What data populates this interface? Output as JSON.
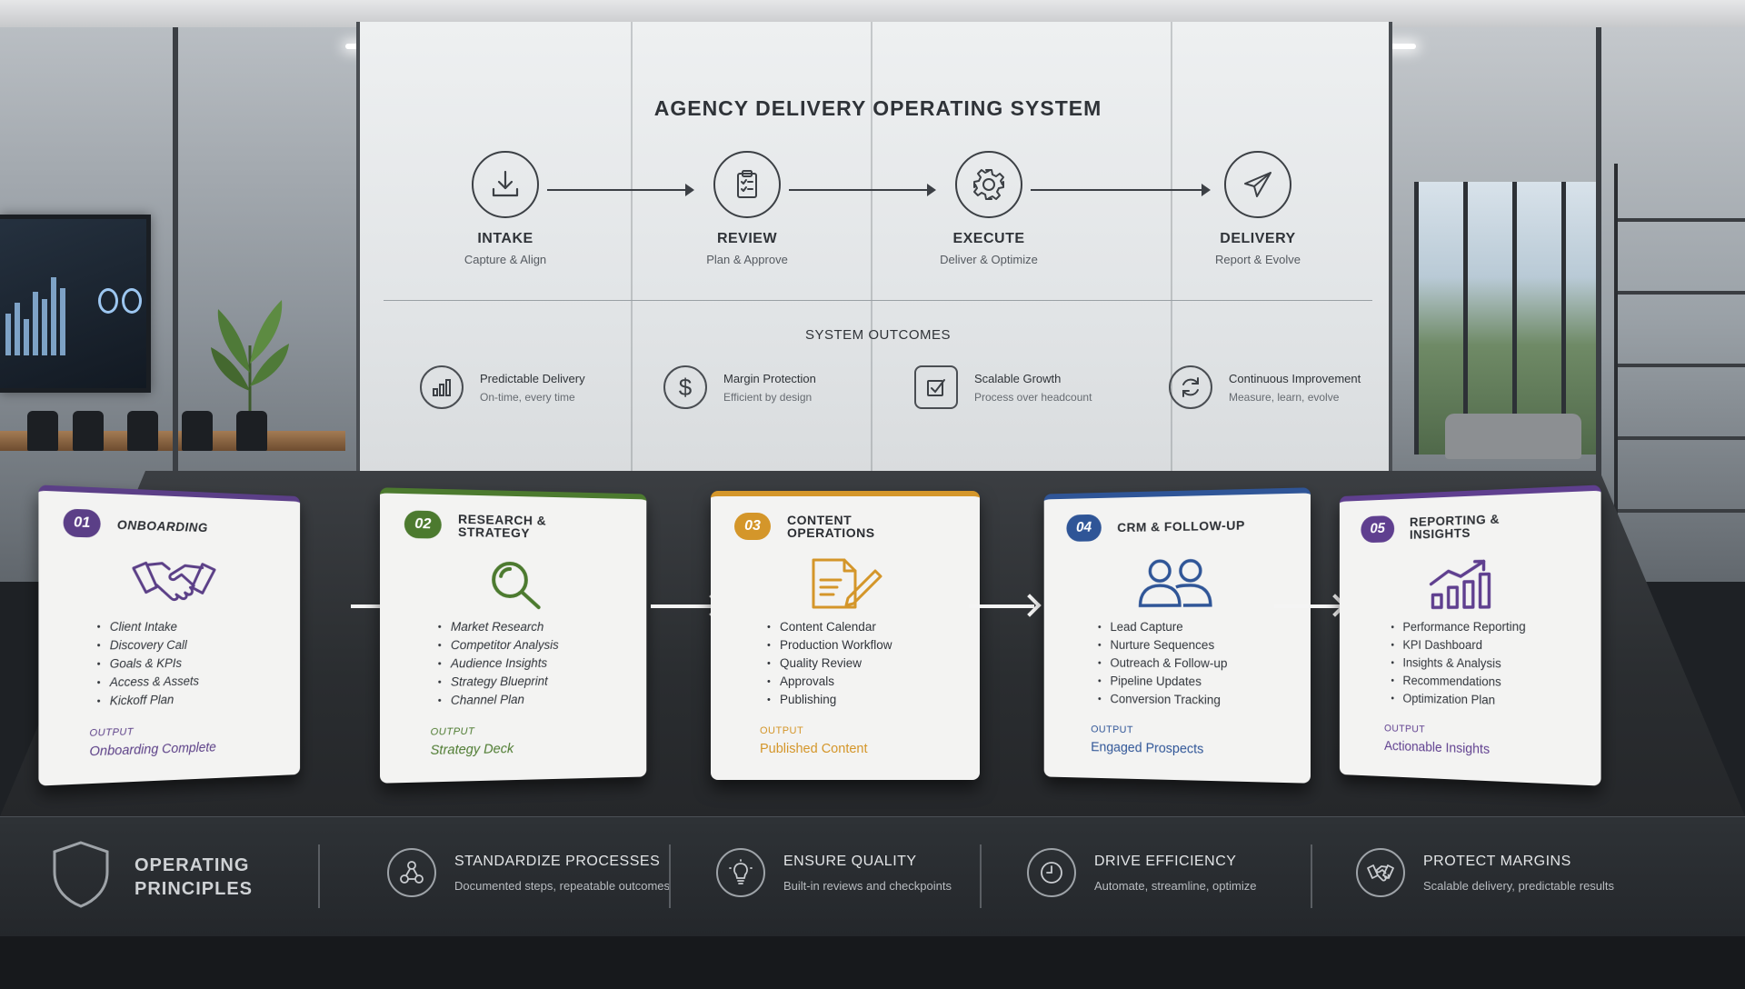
{
  "board": {
    "title": "AGENCY DELIVERY OPERATING SYSTEM",
    "stages": [
      {
        "title": "INTAKE",
        "subtitle": "Capture & Align",
        "icon": "download-icon"
      },
      {
        "title": "REVIEW",
        "subtitle": "Plan & Approve",
        "icon": "clipboard-check-icon"
      },
      {
        "title": "EXECUTE",
        "subtitle": "Deliver & Optimize",
        "icon": "gear-icon"
      },
      {
        "title": "DELIVERY",
        "subtitle": "Report & Evolve",
        "icon": "paper-plane-icon"
      }
    ],
    "outcomes_title": "SYSTEM OUTCOMES",
    "outcomes": [
      {
        "title": "Predictable Delivery",
        "subtitle": "On-time, every time",
        "icon": "bar-chart-icon"
      },
      {
        "title": "Margin Protection",
        "subtitle": "Efficient by design",
        "icon": "dollar-icon"
      },
      {
        "title": "Scalable Growth",
        "subtitle": "Process over headcount",
        "icon": "checkbox-icon"
      },
      {
        "title": "Continuous Improvement",
        "subtitle": "Measure, learn, evolve",
        "icon": "refresh-icon"
      }
    ]
  },
  "cards": [
    {
      "number": "01",
      "title": "ONBOARDING",
      "color": "#5b3f87",
      "icon": "handshake-icon",
      "items": [
        "Client Intake",
        "Discovery Call",
        "Goals & KPIs",
        "Access & Assets",
        "Kickoff Plan"
      ],
      "output_label": "OUTPUT",
      "output": "Onboarding Complete"
    },
    {
      "number": "02",
      "title": "RESEARCH & STRATEGY",
      "color": "#4c7a2f",
      "icon": "magnifier-icon",
      "items": [
        "Market Research",
        "Competitor Analysis",
        "Audience Insights",
        "Strategy Blueprint",
        "Channel Plan"
      ],
      "output_label": "OUTPUT",
      "output": "Strategy Deck"
    },
    {
      "number": "03",
      "title": "CONTENT OPERATIONS",
      "color": "#d4962a",
      "icon": "document-pen-icon",
      "items": [
        "Content Calendar",
        "Production Workflow",
        "Quality Review",
        "Approvals",
        "Publishing"
      ],
      "output_label": "OUTPUT",
      "output": "Published Content"
    },
    {
      "number": "04",
      "title": "CRM & FOLLOW-UP",
      "color": "#2f5597",
      "icon": "users-icon",
      "items": [
        "Lead Capture",
        "Nurture Sequences",
        "Outreach & Follow-up",
        "Pipeline Updates",
        "Conversion Tracking"
      ],
      "output_label": "OUTPUT",
      "output": "Engaged Prospects"
    },
    {
      "number": "05",
      "title": "REPORTING & INSIGHTS",
      "color": "#5f3f8f",
      "icon": "growth-chart-icon",
      "items": [
        "Performance Reporting",
        "KPI Dashboard",
        "Insights & Analysis",
        "Recommendations",
        "Optimization Plan"
      ],
      "output_label": "OUTPUT",
      "output": "Actionable Insights"
    }
  ],
  "principles": {
    "title": "OPERATING PRINCIPLES",
    "items": [
      {
        "title": "STANDARDIZE PROCESSES",
        "subtitle": "Documented steps, repeatable outcomes",
        "icon": "network-icon"
      },
      {
        "title": "ENSURE QUALITY",
        "subtitle": "Built-in reviews and checkpoints",
        "icon": "lightbulb-icon"
      },
      {
        "title": "DRIVE EFFICIENCY",
        "subtitle": "Automate, streamline, optimize",
        "icon": "clock-icon"
      },
      {
        "title": "PROTECT MARGINS",
        "subtitle": "Scalable delivery, predictable results",
        "icon": "handshake-icon"
      }
    ]
  }
}
